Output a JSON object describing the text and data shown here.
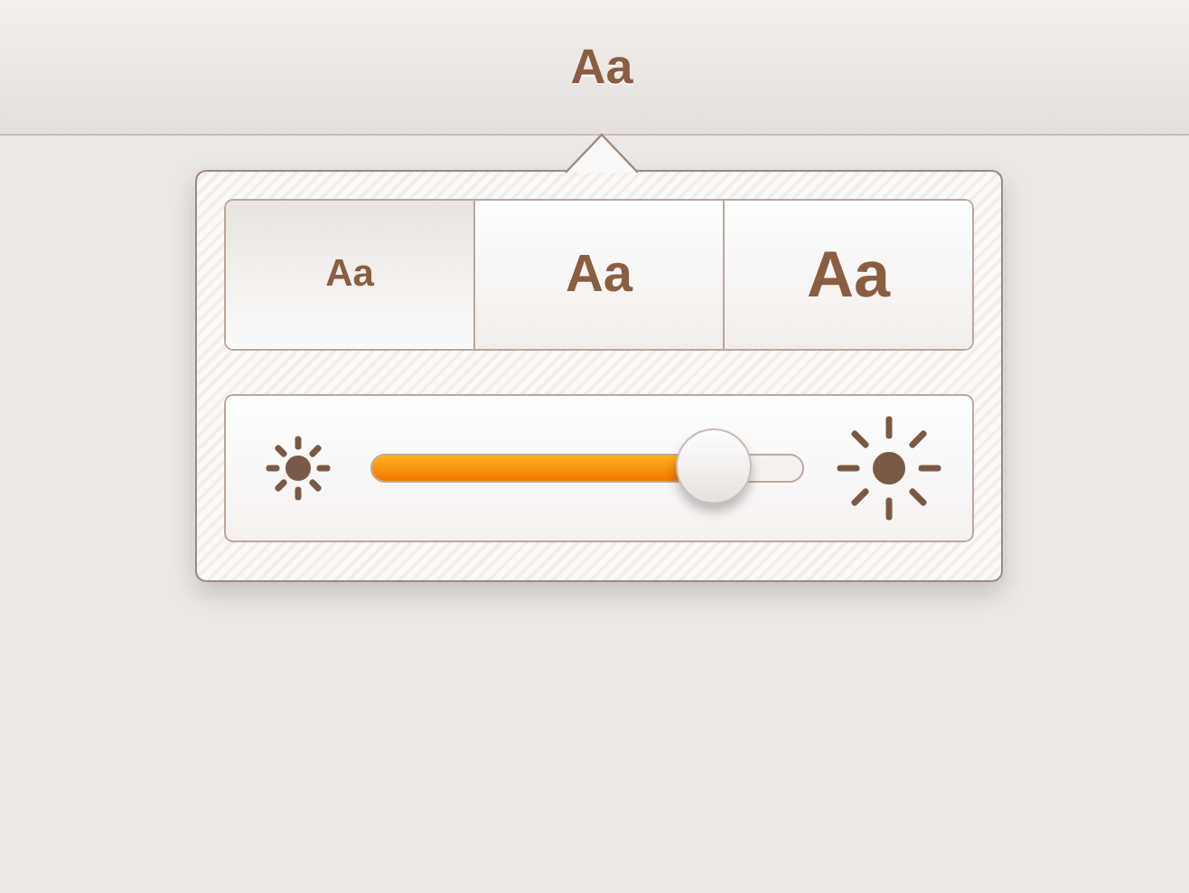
{
  "toolbar": {
    "font_button": "Aa"
  },
  "popover": {
    "text_sizes": [
      {
        "label": "Aa",
        "selected": true
      },
      {
        "label": "Aa",
        "selected": false
      },
      {
        "label": "Aa",
        "selected": false
      }
    ],
    "brightness": {
      "level": 0.79
    }
  }
}
